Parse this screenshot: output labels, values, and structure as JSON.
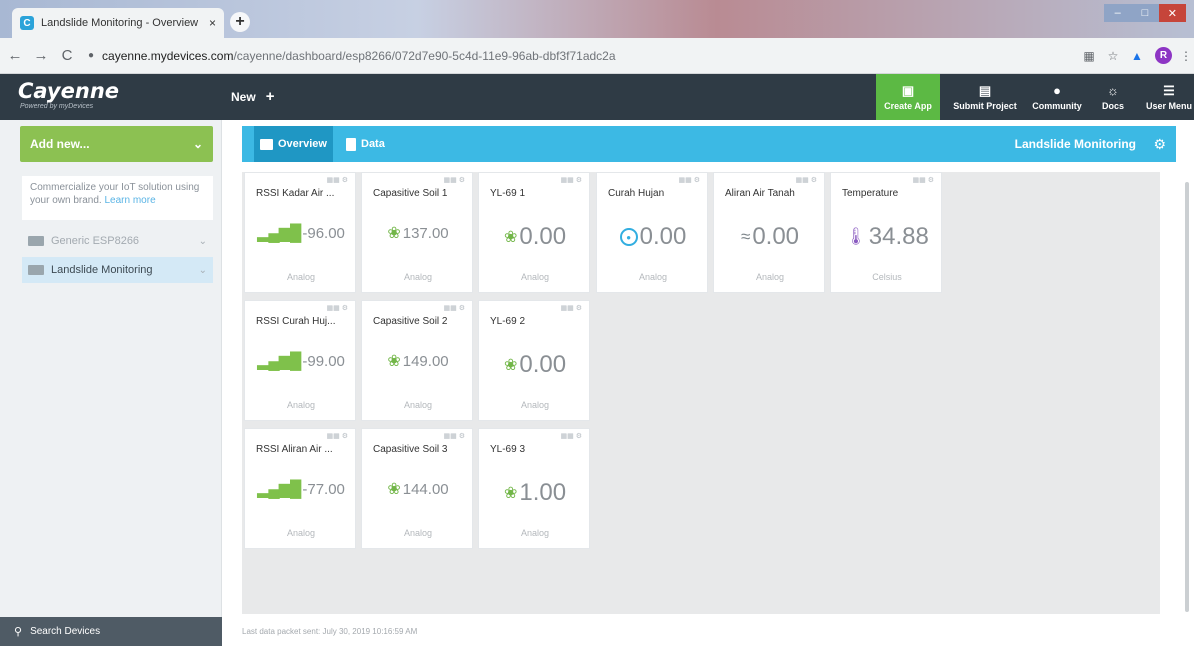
{
  "browser": {
    "tab_title": "Landslide Monitoring - Overview",
    "tab_close": "×",
    "new_tab": "+",
    "back": "←",
    "forward": "→",
    "reload": "C",
    "url_domain": "cayenne.mydevices.com",
    "url_path": "/cayenne/dashboard/esp8266/072d7e90-5c4d-11e9-96ab-dbf3f71adc2a",
    "profile_initial": "R",
    "star": "☆",
    "menu": "⋮"
  },
  "app": {
    "brand": "Cayenne",
    "brand_sub": "Powered by myDevices",
    "new_label": "New",
    "new_plus": "+",
    "nav": {
      "create_app": "Create App",
      "submit_project": "Submit Project",
      "community": "Community",
      "docs": "Docs",
      "user_menu": "User Menu"
    }
  },
  "sidebar": {
    "add_new": "Add new...",
    "promo_text": "Commercialize your IoT solution using your own brand.",
    "promo_link": "Learn more",
    "devices": [
      {
        "label": "Generic ESP8266"
      },
      {
        "label": "Landslide Monitoring"
      }
    ],
    "search_label": "Search Devices"
  },
  "main": {
    "tabs": {
      "overview": "Overview",
      "data": "Data"
    },
    "project_title": "Landslide Monitoring",
    "footer": "Last data packet sent: July 30, 2019 10:16:59 AM",
    "colors": {
      "accent_blue": "#3cb9e4",
      "accent_green": "#8cc152",
      "header_dark": "#2f3b45"
    },
    "widgets": [
      {
        "name": "RSSI Kadar Air ...",
        "value": "-96.00",
        "unit": "Analog",
        "icon": "signal-bars-icon"
      },
      {
        "name": "Capasitive Soil 1",
        "value": "137.00",
        "unit": "Analog",
        "icon": "plant-icon"
      },
      {
        "name": "YL-69 1",
        "value": "0.00",
        "unit": "Analog",
        "icon": "plant-icon"
      },
      {
        "name": "Curah Hujan",
        "value": "0.00",
        "unit": "Analog",
        "icon": "rain-gauge-icon"
      },
      {
        "name": "Aliran Air Tanah",
        "value": "0.00",
        "unit": "Analog",
        "icon": "water-flow-icon"
      },
      {
        "name": "Temperature",
        "value": "34.88",
        "unit": "Celsius",
        "icon": "thermometer-icon"
      },
      {
        "name": "RSSI Curah Huj...",
        "value": "-99.00",
        "unit": "Analog",
        "icon": "signal-bars-icon"
      },
      {
        "name": "Capasitive Soil 2",
        "value": "149.00",
        "unit": "Analog",
        "icon": "plant-icon"
      },
      {
        "name": "YL-69 2",
        "value": "0.00",
        "unit": "Analog",
        "icon": "plant-icon"
      },
      {
        "name": "RSSI Aliran Air ...",
        "value": "-77.00",
        "unit": "Analog",
        "icon": "signal-bars-icon"
      },
      {
        "name": "Capasitive Soil 3",
        "value": "144.00",
        "unit": "Analog",
        "icon": "plant-icon"
      },
      {
        "name": "YL-69 3",
        "value": "1.00",
        "unit": "Analog",
        "icon": "plant-icon"
      }
    ]
  }
}
